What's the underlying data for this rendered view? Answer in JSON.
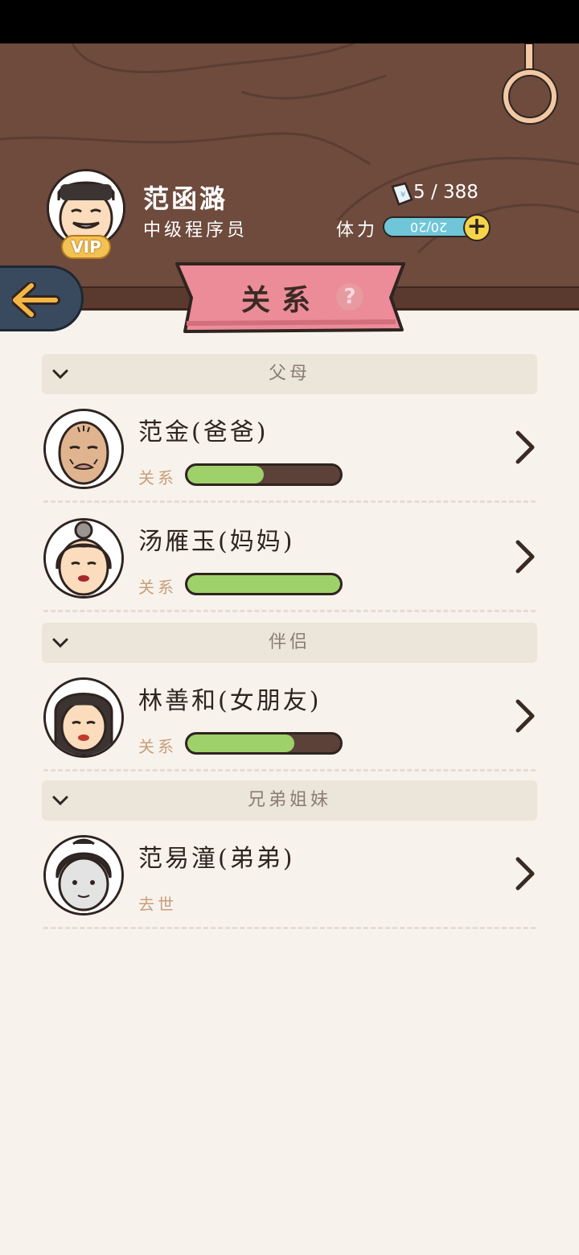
{
  "player": {
    "name": "范函潞",
    "title": "中级程序员",
    "vip": "VIP",
    "money": "51388",
    "money_display": "5 / 388",
    "stamina_label": "体力",
    "stamina": "20/20",
    "stamina_fraction": 1.0
  },
  "page": {
    "title": "关系",
    "help": "?"
  },
  "sections": [
    {
      "label": "父母",
      "people": [
        {
          "name": "范金(爸爸)",
          "relation_label": "关系",
          "relation_level": 0.5
        },
        {
          "name": "汤雁玉(妈妈)",
          "relation_label": "关系",
          "relation_level": 1.0
        }
      ]
    },
    {
      "label": "伴侣",
      "people": [
        {
          "name": "林善和(女朋友)",
          "relation_label": "关系",
          "relation_level": 0.7
        }
      ]
    },
    {
      "label": "兄弟姐妹",
      "people": [
        {
          "name": "范易潼(弟弟)",
          "status": "去世"
        }
      ]
    }
  ],
  "colors": {
    "header_bg": "#6e4b3d",
    "banner": "#ec8c98",
    "relation_fill": "#9fd16a",
    "stamina": "#6fc6d9"
  }
}
